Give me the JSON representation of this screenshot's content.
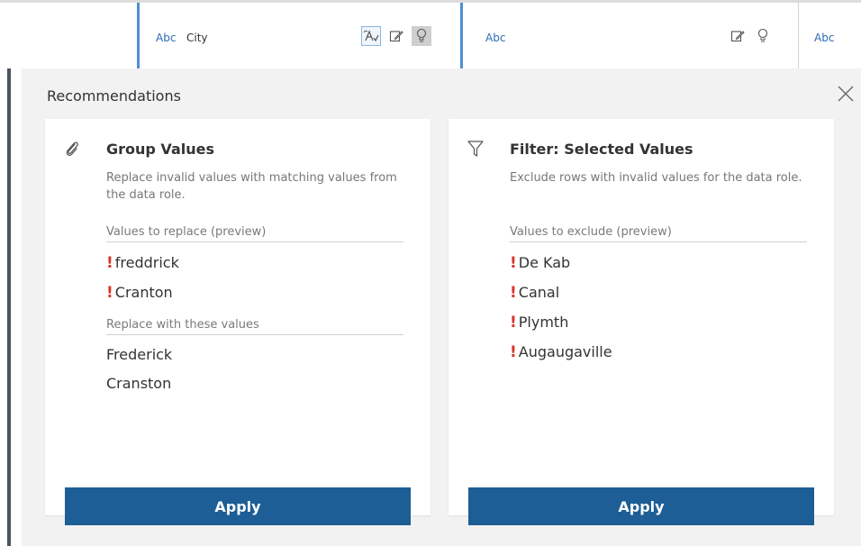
{
  "columns": [
    {
      "type_label": "Abc",
      "name": "City"
    },
    {
      "type_label": "Abc",
      "name": ""
    },
    {
      "type_label": "Abc",
      "name": ""
    }
  ],
  "recommendations": {
    "title": "Recommendations",
    "cards": [
      {
        "icon": "paperclip-icon",
        "title": "Group Values",
        "description": "Replace invalid values with matching values from the data role.",
        "sections": [
          {
            "label": "Values to replace (preview)",
            "values": [
              "freddrick",
              "Cranton"
            ],
            "invalid": true
          },
          {
            "label": "Replace with these values",
            "values": [
              "Frederick",
              "Cranston"
            ],
            "invalid": false
          }
        ],
        "apply_label": "Apply"
      },
      {
        "icon": "filter-icon",
        "title": "Filter: Selected Values",
        "description": "Exclude rows with invalid values for the data role.",
        "sections": [
          {
            "label": "Values to exclude (preview)",
            "values": [
              "De Kab",
              "Canal",
              "Plymth",
              "Augaugaville"
            ],
            "invalid": true
          }
        ],
        "apply_label": "Apply"
      }
    ]
  },
  "colors": {
    "accent_blue": "#1c5e95",
    "invalid_marker": "#d8352a",
    "selected_column_border": "#4d8ed4",
    "type_label": "#2c6db2"
  }
}
